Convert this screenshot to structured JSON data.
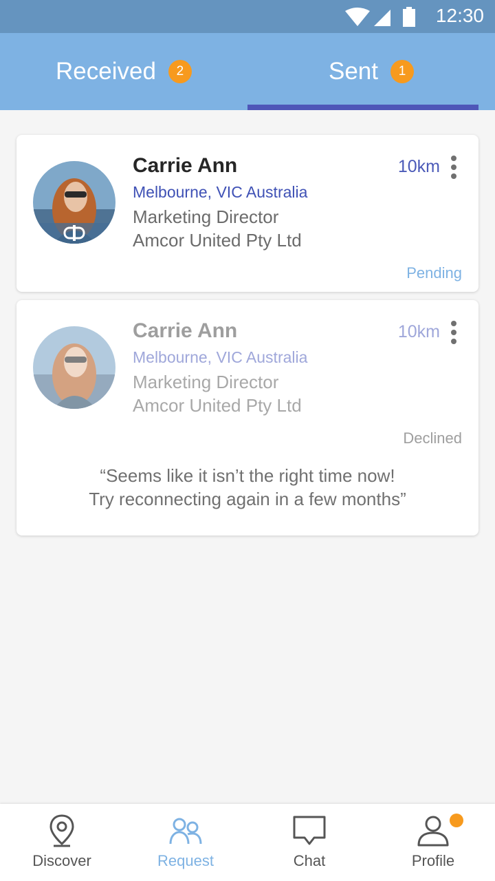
{
  "status_bar": {
    "time": "12:30"
  },
  "tabs": [
    {
      "label": "Received",
      "badge": "2",
      "active": false
    },
    {
      "label": "Sent",
      "badge": "1",
      "active": true
    }
  ],
  "cards": [
    {
      "name": "Carrie Ann",
      "location": "Melbourne, VIC Australia",
      "title": "Marketing Director",
      "company": "Amcor United Pty Ltd",
      "distance": "10km",
      "status": "Pending"
    },
    {
      "name": "Carrie Ann",
      "location": "Melbourne, VIC Australia",
      "title": "Marketing Director",
      "company": "Amcor United Pty Ltd",
      "distance": "10km",
      "status": "Declined",
      "message_line1": "“Seems like it isn’t the right time now!",
      "message_line2": "Try reconnecting again in a few months”"
    }
  ],
  "bottom_nav": [
    {
      "label": "Discover",
      "icon": "location-pin-icon"
    },
    {
      "label": "Request",
      "icon": "people-icon",
      "active": true
    },
    {
      "label": "Chat",
      "icon": "chat-bubble-icon"
    },
    {
      "label": "Profile",
      "icon": "person-icon",
      "notification": true
    }
  ],
  "colors": {
    "header": "#7eb2e3",
    "status_bar": "#6594bf",
    "indicator": "#4e56b8",
    "badge": "#f79a1e",
    "accent_blue": "#3f51b5"
  }
}
